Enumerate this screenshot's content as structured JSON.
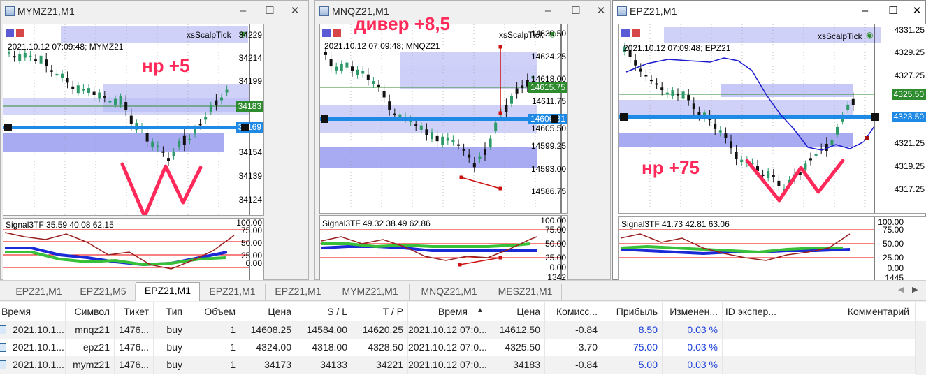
{
  "windows": [
    {
      "title": "MYMZ21,M1",
      "symbol_line": "2021.10.12 07:09:48; MYMZ21",
      "indicator_name": "xsScalpTick",
      "prices": [
        "34229",
        "34214",
        "34199",
        "34183",
        "34169",
        "34154",
        "34139",
        "34124"
      ],
      "current_price": "34183",
      "level_price": "34169",
      "osc_text": "Signal3TF 35.59 40.08 62.15",
      "osc_levels": [
        "100.00",
        "75.00",
        "50.00",
        "25.00",
        "0.00"
      ],
      "annotation": "нр +5"
    },
    {
      "title": "MNQZ21,M1",
      "symbol_line": "2021.10.12 07:09:48; MNQZ21",
      "indicator_name": "xsScalpTick",
      "prices": [
        "14630.50",
        "14624.25",
        "14618.00",
        "14615.75",
        "14611.75",
        "14606.81",
        "14605.50",
        "14599.25",
        "14593.00",
        "14586.75"
      ],
      "current_price": "14615.75",
      "level_price": "14606.81",
      "osc_text": "Signal3TF 49.32 38.49 62.86",
      "osc_levels": [
        "100.00",
        "75.00",
        "50.00",
        "25.00",
        "0.00"
      ],
      "osc_extra": "1342",
      "annotation": "дивер +8,5"
    },
    {
      "title": "EPZ21,M1",
      "symbol_line": "2021.10.12 07:09:48; EPZ21",
      "indicator_name": "xsScalpTick",
      "prices": [
        "4331.25",
        "4329.25",
        "4327.25",
        "4325.50",
        "4323.50",
        "4321.25",
        "4319.25",
        "4317.25"
      ],
      "current_price": "4325.50",
      "level_price": "4323.50",
      "osc_text": "Signal3TF 41.73 42.81 63.06",
      "osc_levels": [
        "100.00",
        "75.00",
        "50.00",
        "25.00",
        "0.00"
      ],
      "osc_extra": "1445",
      "annotation": "нр +75"
    }
  ],
  "colors": {
    "bull": "#2e9a6a",
    "bear": "#111111",
    "zone": "#b8baf5",
    "level_line": "#1e8ae6",
    "price_tag": "#2e8b2e",
    "level_tag": "#1e8ae6",
    "annotation": "#ff2a5a"
  },
  "tabs": [
    "EPZ21,M1",
    "EPZ21,M5",
    "EPZ21,M1",
    "EPZ21,M1",
    "EPZ21,M1",
    "MYMZ21,M1",
    "MNQZ21,M1",
    "MESZ21,M1"
  ],
  "selected_tab": 2,
  "table": {
    "headers": [
      "Время",
      "Символ",
      "Тикет",
      "Тип",
      "Объем",
      "Цена",
      "S / L",
      "T / P",
      "Время",
      "Цена",
      "Комисс...",
      "Прибыль",
      "Изменен...",
      "ID экспер...",
      "Комментарий"
    ],
    "sort_indicator": "▲",
    "rows": [
      [
        "2021.10.1...",
        "mnqz21",
        "1476...",
        "buy",
        "1",
        "14608.25",
        "14584.00",
        "14620.25",
        "2021.10.12 07:0...",
        "14612.50",
        "-0.84",
        "8.50",
        "0.03 %",
        "",
        ""
      ],
      [
        "2021.10.1...",
        "epz21",
        "1476...",
        "buy",
        "1",
        "4324.00",
        "4318.00",
        "4328.50",
        "2021.10.12 07:0...",
        "4325.50",
        "-3.70",
        "75.00",
        "0.03 %",
        "",
        ""
      ],
      [
        "2021.10.1...",
        "mymz21",
        "1476...",
        "buy",
        "1",
        "34173",
        "34133",
        "34221",
        "2021.10.12 07:0...",
        "34183",
        "-0.84",
        "5.00",
        "0.03 %",
        "",
        ""
      ]
    ]
  }
}
